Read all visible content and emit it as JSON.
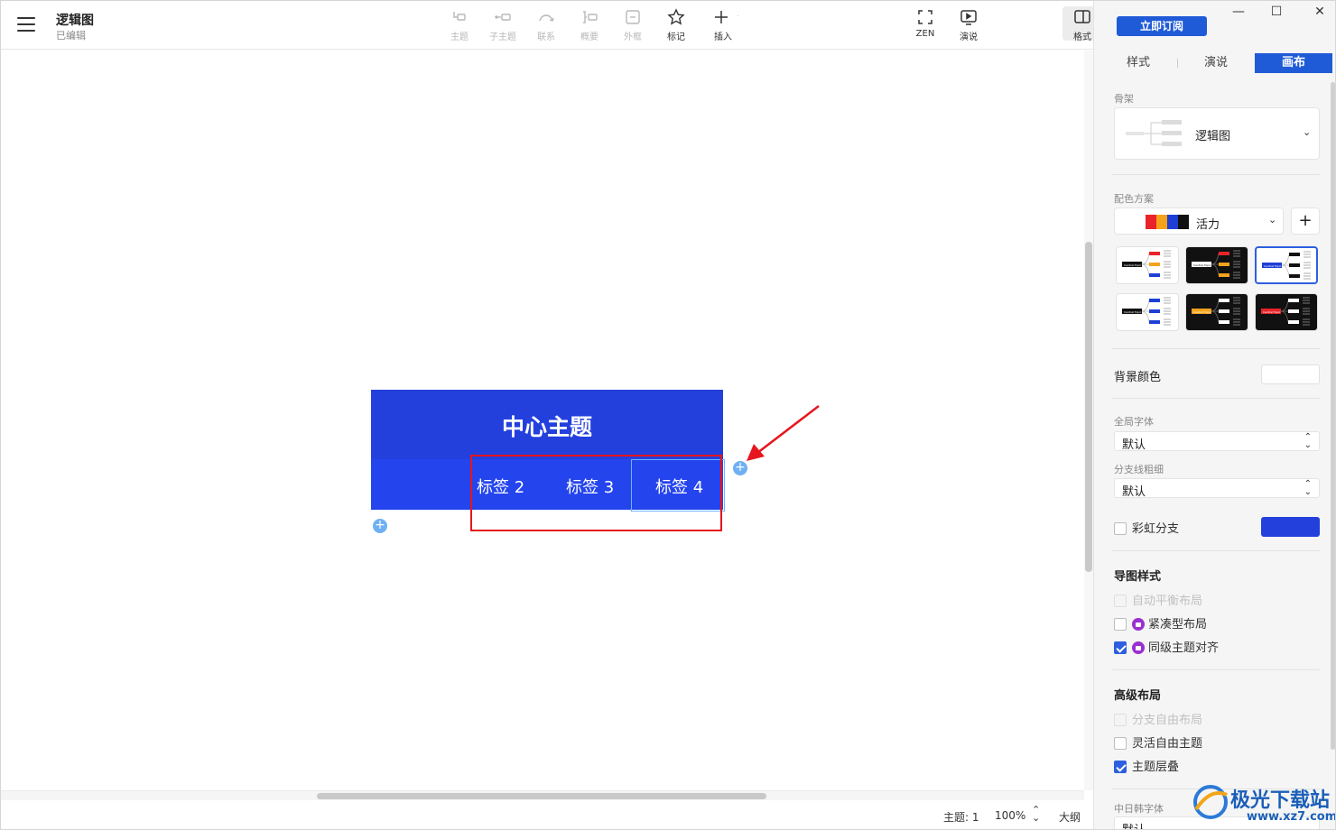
{
  "document": {
    "title": "逻辑图",
    "status": "已编辑"
  },
  "toolbar": {
    "topic": "主题",
    "subtopic": "子主题",
    "relation": "联系",
    "summary": "概要",
    "boundary": "外框",
    "marker": "标记",
    "insert": "插入",
    "zen": "ZEN",
    "present": "演说",
    "format": "格式"
  },
  "canvas": {
    "central_topic": "中心主题",
    "labels": [
      "标签 2",
      "标签 3",
      "标签 4"
    ],
    "add_symbol": "+"
  },
  "status": {
    "topic_count": "主题: 1",
    "zoom": "100%",
    "outline": "大纲"
  },
  "panel": {
    "subscribe": "立即订阅",
    "tabs": [
      "样式",
      "演说",
      "画布"
    ],
    "active_tab": "画布",
    "skeleton_label": "骨架",
    "skeleton_value": "逻辑图",
    "color_scheme_label": "配色方案",
    "color_scheme_value": "活力",
    "color_scheme_swatches": [
      "#e9242a",
      "#f5a21b",
      "#1d3fd6",
      "#111111"
    ],
    "add_symbol": "+",
    "theme_center_text": "Central Topic",
    "background_label": "背景颜色",
    "background_color": "#ffffff",
    "global_font_label": "全局字体",
    "global_font_value": "默认",
    "branch_width_label": "分支线粗细",
    "branch_width_value": "默认",
    "rainbow_branch": "彩虹分支",
    "rainbow_color": "#2340dd",
    "map_style_head": "导图样式",
    "auto_balance": "自动平衡布局",
    "compact_layout": "紧凑型布局",
    "align_same_level": "同级主题对齐",
    "advanced_head": "高级布局",
    "free_branch": "分支自由布局",
    "flexible_topic": "灵活自由主题",
    "topic_overlap": "主题层叠",
    "cjk_font_label": "中日韩字体",
    "cjk_font_value": "默认"
  },
  "watermark": {
    "text": "极光下载站",
    "url": "www.xz7.com"
  },
  "colors": {
    "accent": "#1f5bd6",
    "topic_blue": "#2340dd",
    "label_blue": "#2444ee",
    "annotation_red": "#e5161d"
  }
}
